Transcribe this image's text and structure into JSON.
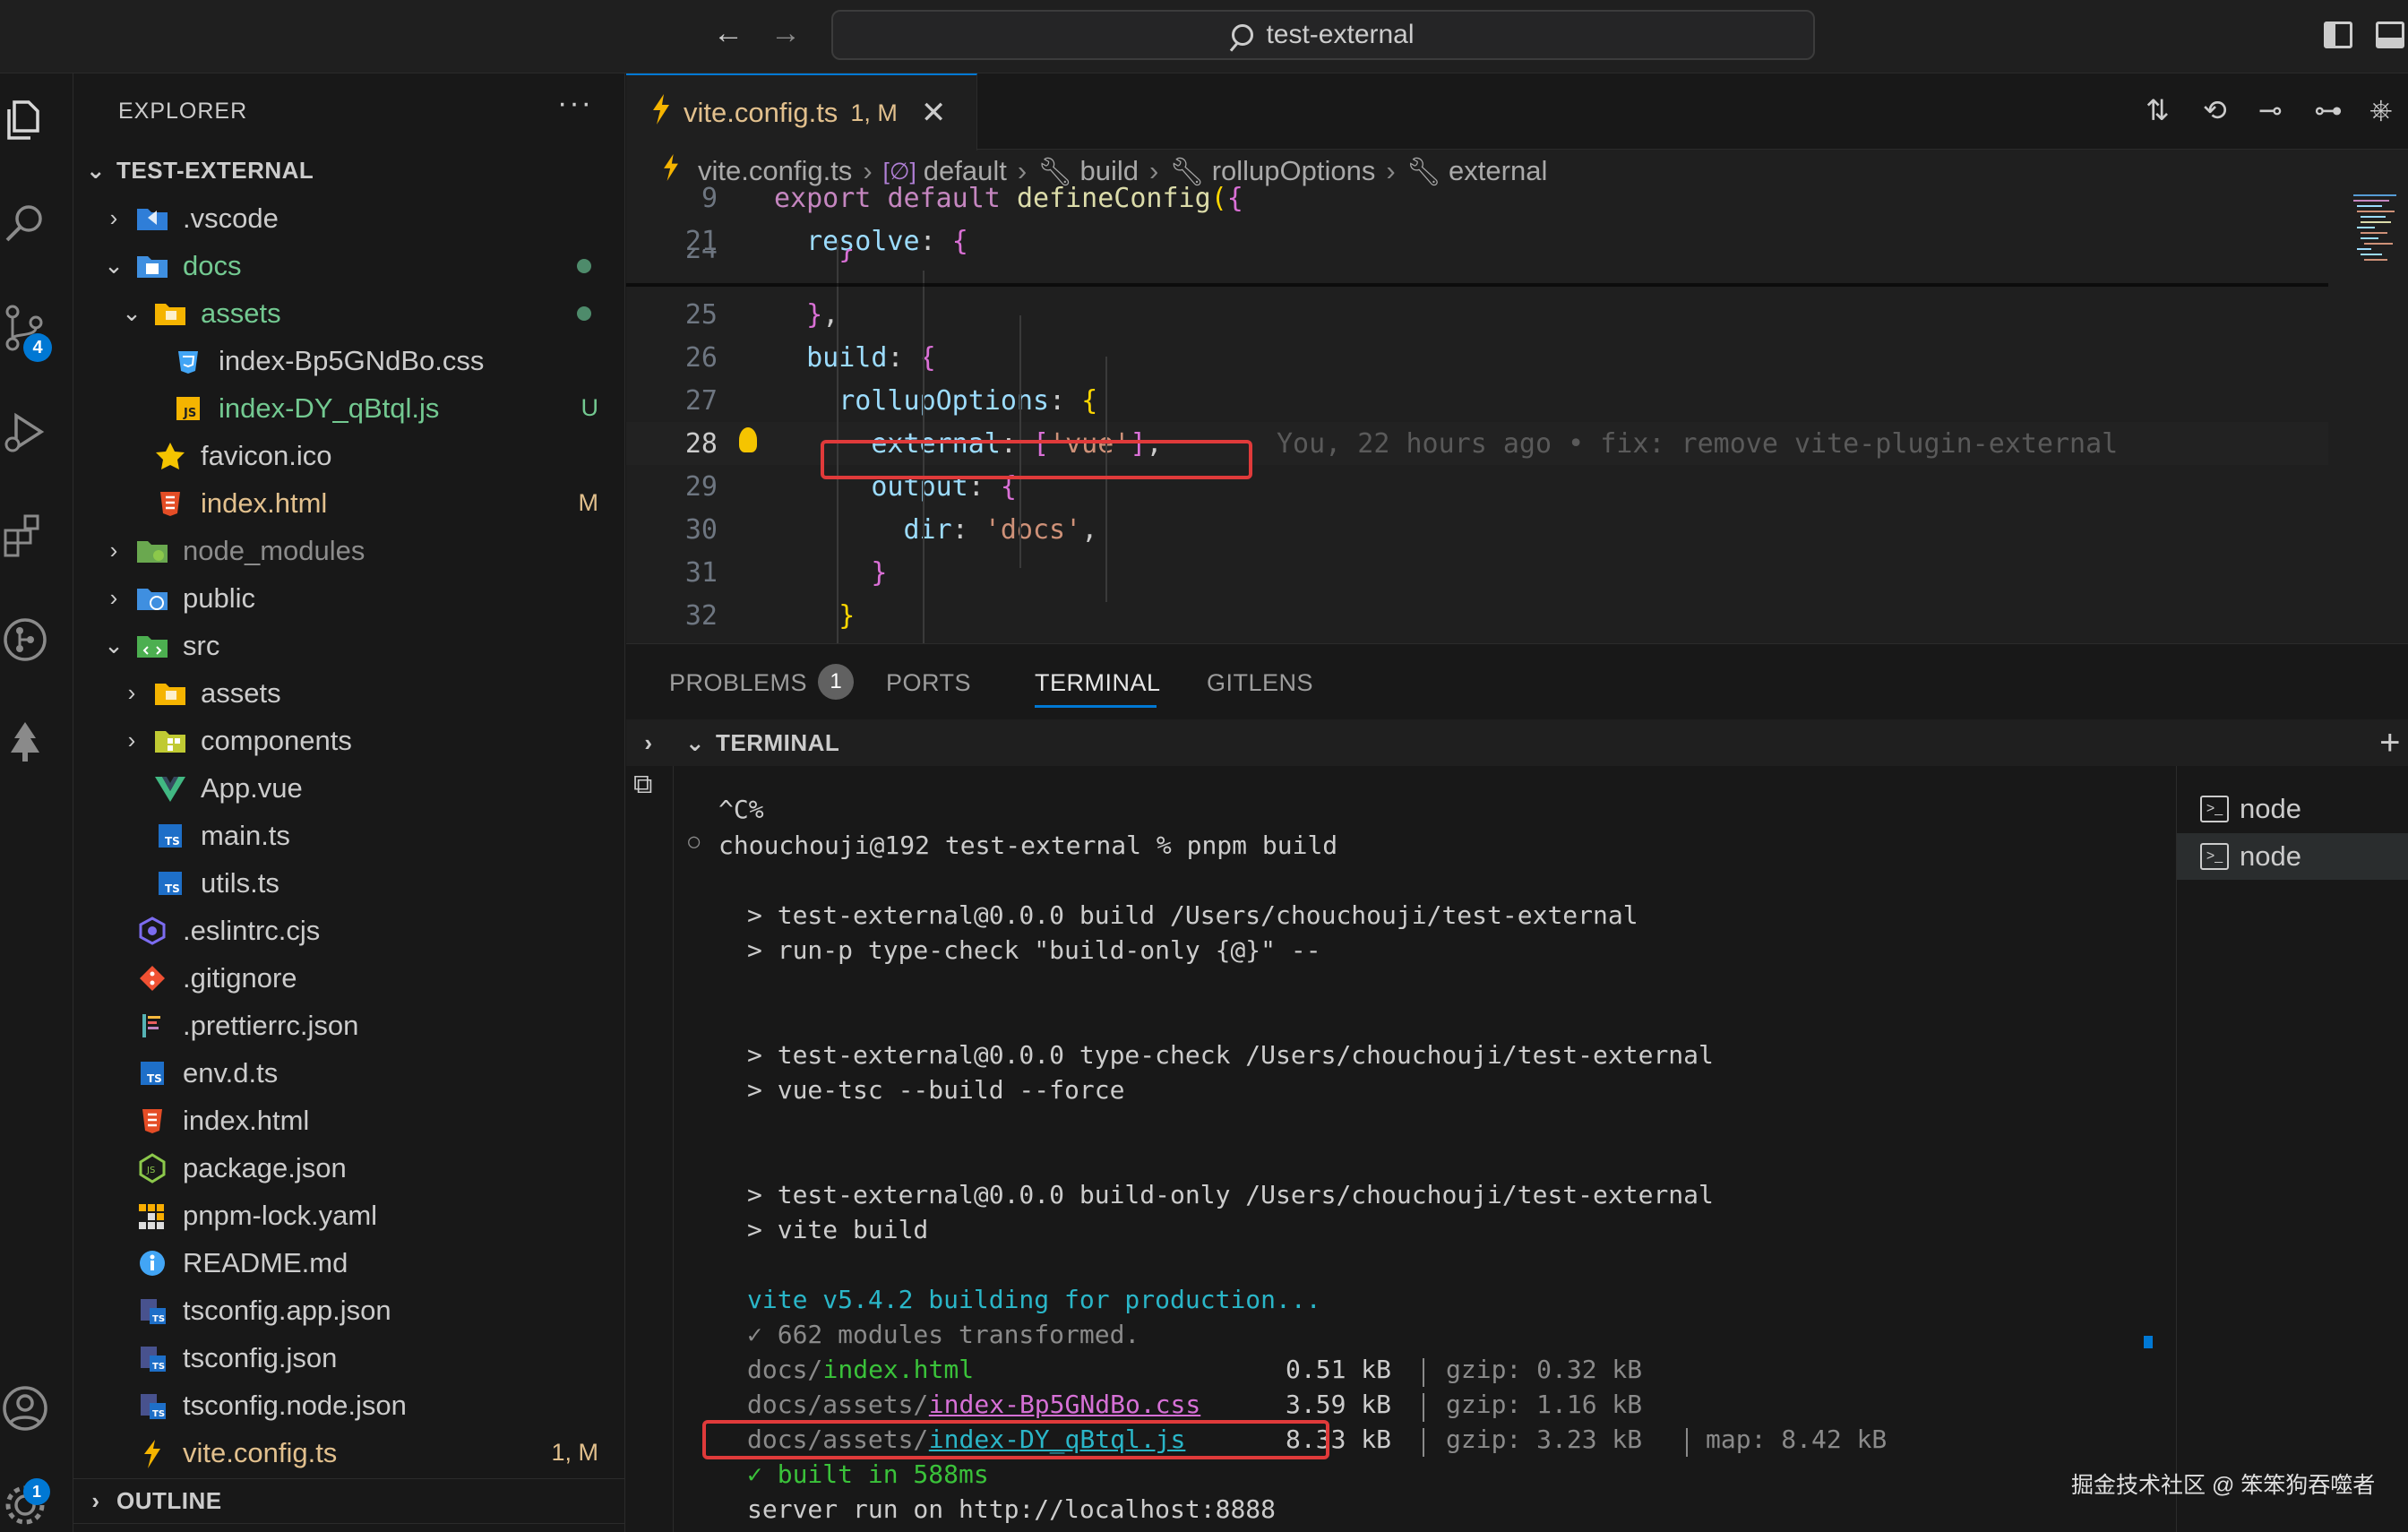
{
  "titlebar": {
    "search_text": "test-external"
  },
  "activity": {
    "scm_badge": "4",
    "account_badge": "1"
  },
  "explorer": {
    "title": "EXPLORER",
    "more": "···",
    "root": "TEST-EXTERNAL",
    "items": [
      {
        "label": ".vscode",
        "depth": 1,
        "type": "folder",
        "expanded": false,
        "color": "#cccccc",
        "icon": "folder-vscode-icon"
      },
      {
        "label": "docs",
        "depth": 1,
        "type": "folder",
        "expanded": true,
        "color": "#73c991",
        "icon": "folder-docs-icon",
        "dot": true
      },
      {
        "label": "assets",
        "depth": 2,
        "type": "folder",
        "expanded": true,
        "color": "#73c991",
        "icon": "folder-assets-icon",
        "dot": true
      },
      {
        "label": "index-Bp5GNdBo.css",
        "depth": 3,
        "type": "file",
        "color": "#cccccc",
        "icon": "css-file-icon"
      },
      {
        "label": "index-DY_qBtql.js",
        "depth": 3,
        "type": "file",
        "color": "#73c991",
        "icon": "js-file-icon",
        "status": "U",
        "status_color": "#73c991"
      },
      {
        "label": "favicon.ico",
        "depth": 2,
        "type": "file",
        "color": "#cccccc",
        "icon": "star-file-icon"
      },
      {
        "label": "index.html",
        "depth": 2,
        "type": "file",
        "color": "#e2c08d",
        "icon": "html-file-icon",
        "status": "M",
        "status_color": "#e2c08d"
      },
      {
        "label": "node_modules",
        "depth": 1,
        "type": "folder",
        "expanded": false,
        "color": "#8c8c8c",
        "icon": "folder-node-icon"
      },
      {
        "label": "public",
        "depth": 1,
        "type": "folder",
        "expanded": false,
        "color": "#cccccc",
        "icon": "folder-public-icon"
      },
      {
        "label": "src",
        "depth": 1,
        "type": "folder",
        "expanded": true,
        "color": "#cccccc",
        "icon": "folder-src-icon"
      },
      {
        "label": "assets",
        "depth": 2,
        "type": "folder",
        "expanded": false,
        "color": "#cccccc",
        "icon": "folder-assets-icon"
      },
      {
        "label": "components",
        "depth": 2,
        "type": "folder",
        "expanded": false,
        "color": "#cccccc",
        "icon": "folder-components-icon"
      },
      {
        "label": "App.vue",
        "depth": 2,
        "type": "file",
        "color": "#cccccc",
        "icon": "vue-file-icon"
      },
      {
        "label": "main.ts",
        "depth": 2,
        "type": "file",
        "color": "#cccccc",
        "icon": "ts-file-icon"
      },
      {
        "label": "utils.ts",
        "depth": 2,
        "type": "file",
        "color": "#cccccc",
        "icon": "ts-file-icon"
      },
      {
        "label": ".eslintrc.cjs",
        "depth": 1,
        "type": "file",
        "color": "#cccccc",
        "icon": "eslint-file-icon"
      },
      {
        "label": ".gitignore",
        "depth": 1,
        "type": "file",
        "color": "#cccccc",
        "icon": "git-file-icon"
      },
      {
        "label": ".prettierrc.json",
        "depth": 1,
        "type": "file",
        "color": "#cccccc",
        "icon": "prettier-file-icon"
      },
      {
        "label": "env.d.ts",
        "depth": 1,
        "type": "file",
        "color": "#cccccc",
        "icon": "ts-file-icon"
      },
      {
        "label": "index.html",
        "depth": 1,
        "type": "file",
        "color": "#cccccc",
        "icon": "html-file-icon"
      },
      {
        "label": "package.json",
        "depth": 1,
        "type": "file",
        "color": "#cccccc",
        "icon": "nodejs-file-icon"
      },
      {
        "label": "pnpm-lock.yaml",
        "depth": 1,
        "type": "file",
        "color": "#cccccc",
        "icon": "pnpm-file-icon"
      },
      {
        "label": "README.md",
        "depth": 1,
        "type": "file",
        "color": "#cccccc",
        "icon": "info-file-icon"
      },
      {
        "label": "tsconfig.app.json",
        "depth": 1,
        "type": "file",
        "color": "#cccccc",
        "icon": "tsconfig-file-icon"
      },
      {
        "label": "tsconfig.json",
        "depth": 1,
        "type": "file",
        "color": "#cccccc",
        "icon": "tsconfig-file-icon"
      },
      {
        "label": "tsconfig.node.json",
        "depth": 1,
        "type": "file",
        "color": "#cccccc",
        "icon": "tsconfig-file-icon"
      },
      {
        "label": "vite.config.ts",
        "depth": 1,
        "type": "file",
        "color": "#e2c08d",
        "icon": "vite-file-icon",
        "status": "1, M",
        "status_color": "#e2c08d"
      }
    ],
    "outline": "OUTLINE"
  },
  "editor": {
    "tab": {
      "name": "vite.config.ts",
      "status": "1, M",
      "close": "✕"
    },
    "breadcrumb": [
      "vite.config.ts",
      "default",
      "build",
      "rollupOptions",
      "external"
    ],
    "lines": [
      {
        "num": "9",
        "text": "export default defineConfig({"
      },
      {
        "num": "21",
        "text": "  resolve: {"
      },
      {
        "num": "24",
        "text": "    }"
      },
      {
        "num": "25",
        "text": "  },"
      },
      {
        "num": "26",
        "text": "  build: {"
      },
      {
        "num": "27",
        "text": "    rollupOptions: {"
      },
      {
        "num": "28",
        "text": "      external: ['vue'],"
      },
      {
        "num": "29",
        "text": "      output: {"
      },
      {
        "num": "30",
        "text": "        dir: 'docs',"
      },
      {
        "num": "31",
        "text": "      }"
      },
      {
        "num": "32",
        "text": "    }"
      }
    ],
    "blame": "You, 22 hours ago • fix: remove vite-plugin-external"
  },
  "panel": {
    "tabs": [
      "PROBLEMS",
      "PORTS",
      "TERMINAL",
      "GITLENS"
    ],
    "problems_count": "1",
    "terminal_title": "TERMINAL",
    "terminals": [
      "node",
      "node"
    ],
    "output": {
      "ctrl_c": "^C%",
      "prompt": "chouchouji@192 test-external % pnpm build",
      "l1": "> test-external@0.0.0 build /Users/chouchouji/test-external",
      "l2": "> run-p type-check \"build-only {@}\" --",
      "l3": "> test-external@0.0.0 type-check /Users/chouchouji/test-external",
      "l4": "> vue-tsc --build --force",
      "l5": "> test-external@0.0.0 build-only /Users/chouchouji/test-external",
      "l6": "> vite build",
      "vite": "vite v5.4.2 building for production...",
      "transformed": "✓ 662 modules transformed.",
      "rows": [
        {
          "dir": "docs/",
          "file": "index.html",
          "size": "0.51 kB",
          "gzip": "gzip: 0.32 kB",
          "map": ""
        },
        {
          "dir": "docs/assets/",
          "file": "index-Bp5GNdBo.css",
          "size": "3.59 kB",
          "gzip": "gzip: 1.16 kB",
          "map": ""
        },
        {
          "dir": "docs/assets/",
          "file": "index-DY_qBtql.js",
          "size": "8.33 kB",
          "gzip": "gzip: 3.23 kB",
          "map": "map: 8.42 kB"
        }
      ],
      "built": "✓ built in 588ms",
      "server": "server run on http://localhost:8888"
    }
  },
  "watermark": "掘金技术社区 @ 笨笨狗吞噬者",
  "colors": {
    "accent": "#0078d4",
    "highlight_box": "#e03a3a",
    "modified": "#e2c08d",
    "untracked": "#73c991"
  }
}
